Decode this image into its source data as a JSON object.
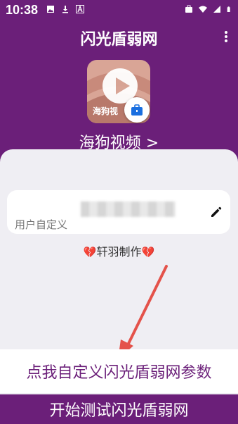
{
  "status_bar": {
    "time": "10:38",
    "left_icons": [
      "image-icon",
      "download-icon",
      "a-icon"
    ],
    "right_icons": [
      "briefcase-icon",
      "wifi-icon",
      "signal-icon",
      "battery-icon"
    ]
  },
  "appbar": {
    "title": "闪光盾弱网",
    "menu_icon": "more-vert-icon"
  },
  "target_app": {
    "icon_label": "海狗视",
    "name": "海狗视频 >"
  },
  "custom_input": {
    "placeholder_hint": "用户自定义",
    "edit_icon": "pencil-icon"
  },
  "author": {
    "left_icon": "broken-heart-icon",
    "text": "轩羽制作",
    "right_icon": "broken-heart-icon"
  },
  "buttons": {
    "custom_params": "点我自定义闪光盾弱网参数",
    "start_test": "开始测试闪光盾弱网"
  },
  "colors": {
    "primary": "#6b1f79",
    "panel": "#efeef3",
    "arrow": "#e4524a"
  }
}
